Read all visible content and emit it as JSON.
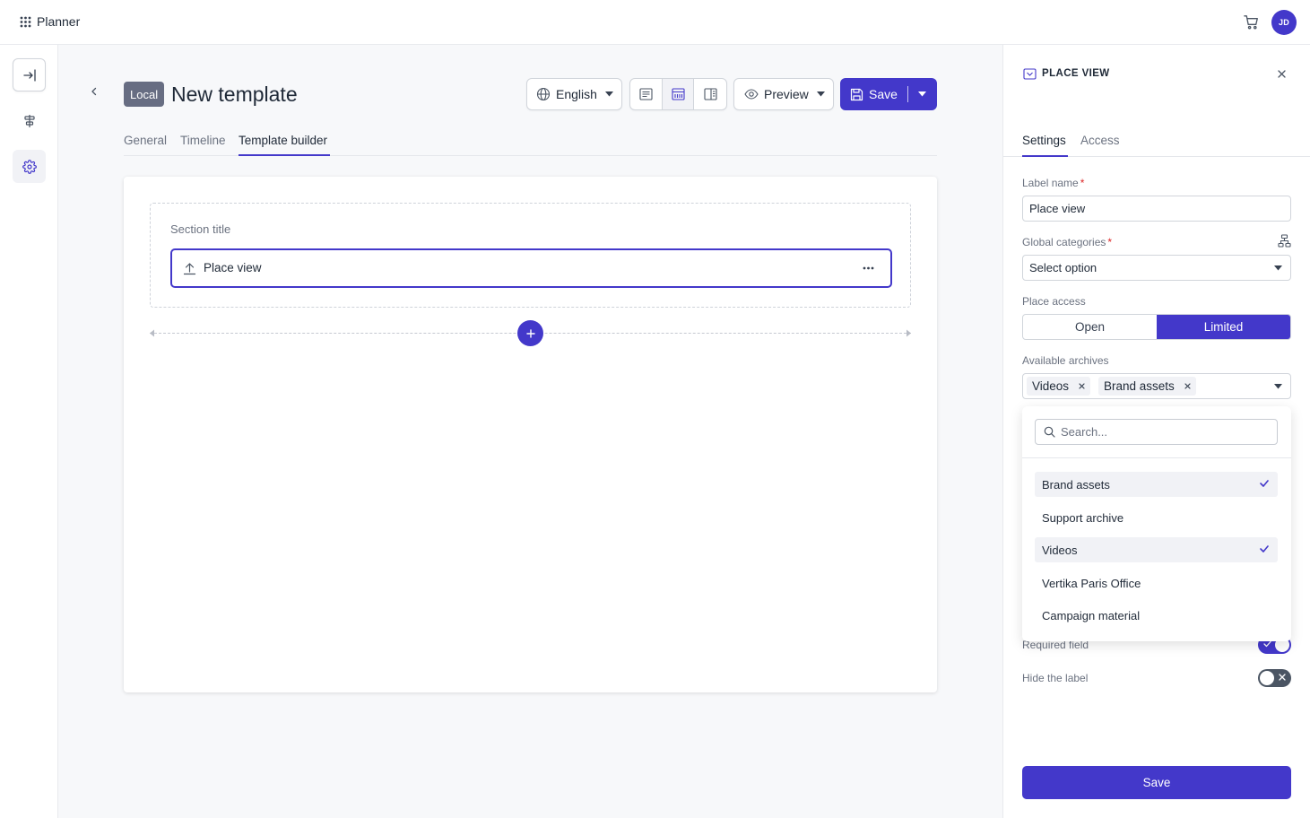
{
  "app": {
    "name": "Planner",
    "user_initials": "JD"
  },
  "header": {
    "badge": "Local",
    "title": "New template",
    "language": "English",
    "preview_label": "Preview",
    "save_label": "Save"
  },
  "tabs": [
    {
      "label": "General",
      "active": false
    },
    {
      "label": "Timeline",
      "active": false
    },
    {
      "label": "Template builder",
      "active": true
    }
  ],
  "builder": {
    "section_title": "Section title",
    "field_label": "Place view"
  },
  "panel": {
    "title": "PLACE VIEW",
    "tabs": [
      {
        "label": "Settings",
        "active": true
      },
      {
        "label": "Access",
        "active": false
      }
    ],
    "label_name": {
      "label": "Label name",
      "required_mark": "*",
      "value": "Place view"
    },
    "global_categories": {
      "label": "Global categories",
      "required_mark": "*",
      "value": "Select option"
    },
    "place_access": {
      "label": "Place access",
      "options": [
        "Open",
        "Limited"
      ],
      "selected": "Limited"
    },
    "available_archives": {
      "label": "Available archives",
      "chips": [
        "Videos",
        "Brand assets"
      ],
      "search_placeholder": "Search...",
      "options": [
        {
          "label": "Brand assets",
          "selected": true
        },
        {
          "label": "Support archive",
          "selected": false
        },
        {
          "label": "Videos",
          "selected": true
        },
        {
          "label": "Vertika Paris Office",
          "selected": false
        },
        {
          "label": "Campaign material",
          "selected": false
        }
      ]
    },
    "required_field": {
      "label": "Required field",
      "on": true
    },
    "hide_label": {
      "label": "Hide the label",
      "on": false
    },
    "save_label": "Save"
  },
  "colors": {
    "accent": "#4338ca",
    "badge": "#676d82",
    "required": "#dc2626"
  }
}
